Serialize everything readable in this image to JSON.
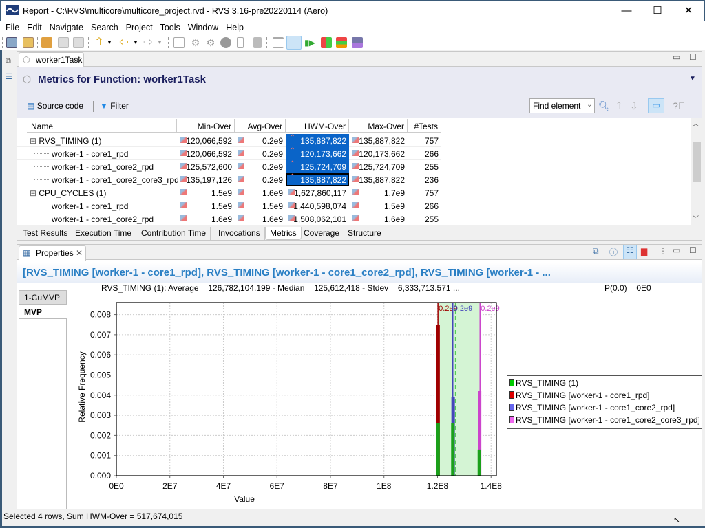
{
  "window": {
    "title": "Report - C:\\RVS\\multicore\\multicore_project.rvd - RVS 3.16-pre20220114 (Aero)",
    "minimize": "—",
    "maximize": "☐",
    "close": "✕"
  },
  "menu": [
    "File",
    "Edit",
    "Navigate",
    "Search",
    "Project",
    "Tools",
    "Window",
    "Help"
  ],
  "editor": {
    "tab_label": "worker1Task",
    "header_title": "Metrics for Function: worker1Task",
    "source_code_label": "Source code",
    "filter_label": "Filter",
    "find_element_label": "Find element",
    "columns": [
      "Name",
      "Min-Over",
      "Avg-Over",
      "HWM-Over",
      "Max-Over",
      "#Tests"
    ],
    "rows": [
      {
        "name": "RVS_TIMING (1)",
        "min": "120,066,592",
        "avg": "0.2e9",
        "hwm": "135,887,822",
        "max": "135,887,822",
        "tests": "757",
        "group": true,
        "selected": true
      },
      {
        "name": "worker-1 - core1_rpd",
        "min": "120,066,592",
        "avg": "0.2e9",
        "hwm": "120,173,662",
        "max": "120,173,662",
        "tests": "266",
        "group": false,
        "selected": true
      },
      {
        "name": "worker-1 - core1_core2_rpd",
        "min": "125,572,600",
        "avg": "0.2e9",
        "hwm": "125,724,709",
        "max": "125,724,709",
        "tests": "255",
        "group": false,
        "selected": true
      },
      {
        "name": "worker-1 - core1_core2_core3_rpd",
        "min": "135,197,126",
        "avg": "0.2e9",
        "hwm": "135,887,822",
        "max": "135,887,822",
        "tests": "236",
        "group": false,
        "selected": true,
        "focused": true
      },
      {
        "name": "CPU_CYCLES (1)",
        "min": "1.5e9",
        "avg": "1.6e9",
        "hwm": "1,627,860,117",
        "max": "1.7e9",
        "tests": "757",
        "group": true,
        "selected": false
      },
      {
        "name": "worker-1 - core1_rpd",
        "min": "1.5e9",
        "avg": "1.5e9",
        "hwm": "1,440,598,074",
        "max": "1.5e9",
        "tests": "266",
        "group": false,
        "selected": false
      },
      {
        "name": "worker-1 - core1_core2_rpd",
        "min": "1.6e9",
        "avg": "1.6e9",
        "hwm": "1,508,062,101",
        "max": "1.6e9",
        "tests": "255",
        "group": false,
        "selected": false
      }
    ],
    "bottom_tabs": [
      "Test Results",
      "Execution Time",
      "Contribution Time",
      "Invocations",
      "Metrics",
      "Coverage",
      "Structure"
    ],
    "active_bottom_tab": "Metrics"
  },
  "properties": {
    "tab_label": "Properties",
    "title": "[RVS_TIMING [worker-1 - core1_rpd], RVS_TIMING [worker-1 - core1_core2_rpd], RVS_TIMING [worker-1 - ...",
    "stats": "RVS_TIMING (1): Average = 126,782,104.199 - Median = 125,612,418 - Stdev = 6,333,713.571 ...",
    "pvalue": "P(0.0) = 0E0",
    "side_tabs": [
      "1-CuMVP",
      "MVP"
    ],
    "active_side_tab": "MVP"
  },
  "chart_data": {
    "type": "bar",
    "title": "",
    "xlabel": "Value",
    "ylabel": "Relative Frequency",
    "xlim": [
      0,
      142000000
    ],
    "ylim": [
      0,
      0.0086
    ],
    "x_ticks": [
      0,
      20000000,
      40000000,
      60000000,
      80000000,
      100000000,
      120000000,
      140000000
    ],
    "x_tick_labels": [
      "0E0",
      "2E7",
      "4E7",
      "6E7",
      "8E7",
      "1E8",
      "1.2E8",
      "1.4E8"
    ],
    "y_ticks": [
      0,
      0.001,
      0.002,
      0.003,
      0.004,
      0.005,
      0.006,
      0.007,
      0.008
    ],
    "y_tick_labels": [
      "0.000",
      "0.001",
      "0.002",
      "0.003",
      "0.004",
      "0.005",
      "0.006",
      "0.007",
      "0.008"
    ],
    "grid": true,
    "legend_position": "right",
    "shaded_range": [
      120066592,
      135887822
    ],
    "mean_line": 126782104,
    "series": [
      {
        "name": "RVS_TIMING (1)",
        "color": "#1aa01a",
        "bars": [
          {
            "x": 120100000,
            "y": 0.0026
          },
          {
            "x": 125600000,
            "y": 0.0026
          },
          {
            "x": 135500000,
            "y": 0.0013
          }
        ]
      },
      {
        "name": "RVS_TIMING [worker-1 - core1_rpd]",
        "color": "#a00000",
        "bars": [
          {
            "x": 120100000,
            "y": 0.0075
          }
        ],
        "hwm_label": "0.2e9",
        "hwm_x": 120173662
      },
      {
        "name": "RVS_TIMING [worker-1 - core1_core2_rpd]",
        "color": "#4444bb",
        "bars": [
          {
            "x": 125700000,
            "y": 0.0039
          }
        ],
        "hwm_label": "0.2e9",
        "hwm_x": 125724709
      },
      {
        "name": "RVS_TIMING [worker-1 - core1_core2_core3_rpd]",
        "color": "#cc44cc",
        "bars": [
          {
            "x": 135600000,
            "y": 0.0042
          }
        ],
        "hwm_label": "0.2e9",
        "hwm_x": 135887822
      }
    ]
  },
  "status": {
    "text": "Selected 4 rows, Sum HWM-Over = 517,674,015"
  }
}
